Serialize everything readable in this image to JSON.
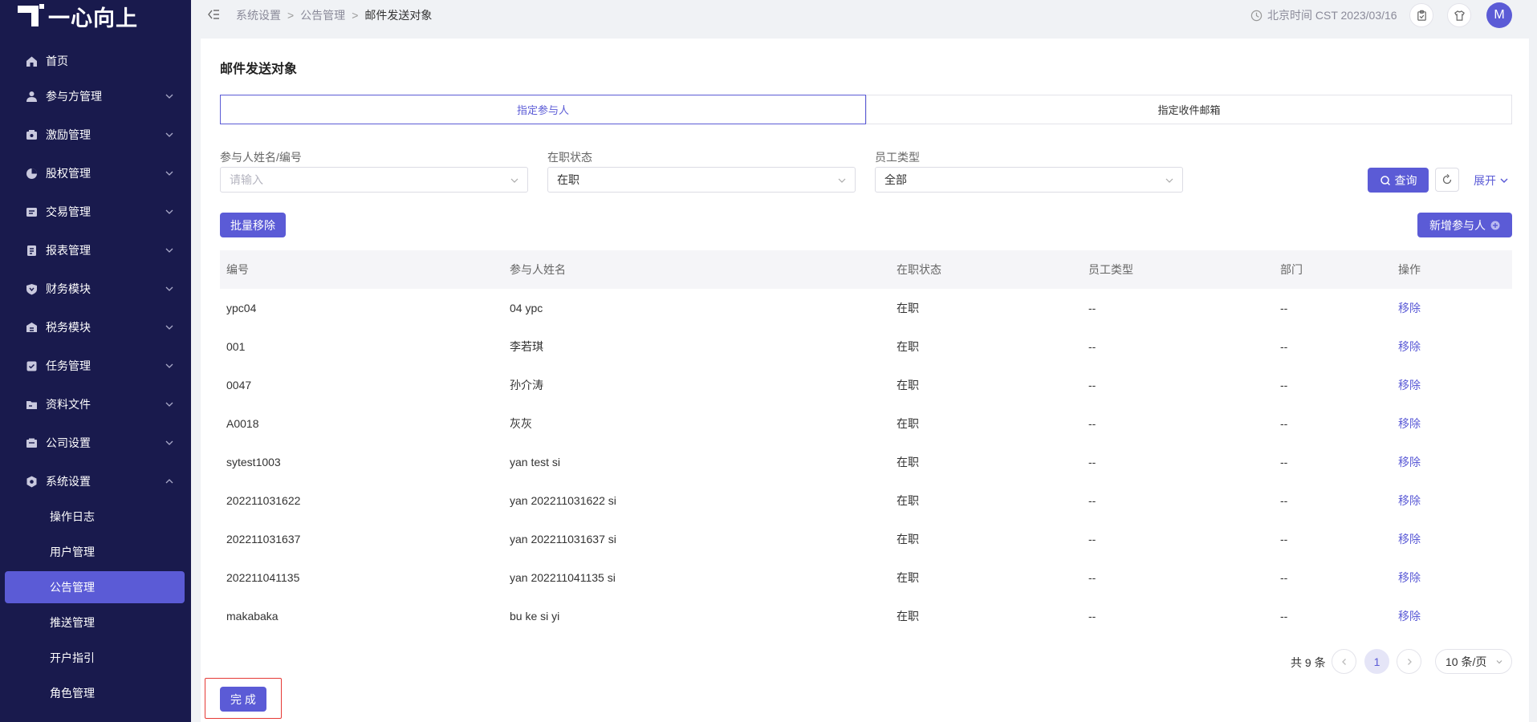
{
  "sidebar": {
    "logo_text": "一心向上",
    "items": [
      {
        "label": "首页",
        "icon": "home-icon"
      },
      {
        "label": "参与方管理",
        "icon": "participants-icon"
      },
      {
        "label": "激励管理",
        "icon": "incentive-icon"
      },
      {
        "label": "股权管理",
        "icon": "equity-icon"
      },
      {
        "label": "交易管理",
        "icon": "trade-icon"
      },
      {
        "label": "报表管理",
        "icon": "report-icon"
      },
      {
        "label": "财务模块",
        "icon": "finance-icon"
      },
      {
        "label": "税务模块",
        "icon": "tax-icon"
      },
      {
        "label": "任务管理",
        "icon": "task-icon"
      },
      {
        "label": "资料文件",
        "icon": "folder-icon"
      },
      {
        "label": "公司设置",
        "icon": "company-icon"
      },
      {
        "label": "系统设置",
        "icon": "system-icon"
      }
    ],
    "sub_items": [
      {
        "label": "操作日志"
      },
      {
        "label": "用户管理"
      },
      {
        "label": "公告管理"
      },
      {
        "label": "推送管理"
      },
      {
        "label": "开户指引"
      },
      {
        "label": "角色管理"
      }
    ]
  },
  "topbar": {
    "breadcrumb": [
      "系统设置",
      "公告管理",
      "邮件发送对象"
    ],
    "clock_text": "北京时间 CST 2023/03/16",
    "avatar_letter": "M"
  },
  "page": {
    "title": "邮件发送对象",
    "tabs": [
      "指定参与人",
      "指定收件邮箱"
    ],
    "filters": [
      {
        "label": "参与人姓名/编号",
        "placeholder": "请输入",
        "value": ""
      },
      {
        "label": "在职状态",
        "value": "在职"
      },
      {
        "label": "员工类型",
        "value": "全部"
      }
    ],
    "query_label": "查询",
    "expand_label": "展开",
    "batch_remove_label": "批量移除",
    "add_participant_label": "新增参与人",
    "done_label": "完 成"
  },
  "table": {
    "columns": [
      "编号",
      "参与人姓名",
      "在职状态",
      "员工类型",
      "部门",
      "操作"
    ],
    "rows": [
      [
        "ypc04",
        "04 ypc",
        "在职",
        "--",
        "--",
        "移除"
      ],
      [
        "001",
        "李若琪",
        "在职",
        "--",
        "--",
        "移除"
      ],
      [
        "0047",
        "孙介涛",
        "在职",
        "--",
        "--",
        "移除"
      ],
      [
        "A0018",
        "灰灰",
        "在职",
        "--",
        "--",
        "移除"
      ],
      [
        "sytest1003",
        "yan test si",
        "在职",
        "--",
        "--",
        "移除"
      ],
      [
        "202211031622",
        "yan 202211031622 si",
        "在职",
        "--",
        "--",
        "移除"
      ],
      [
        "202211031637",
        "yan 202211031637 si",
        "在职",
        "--",
        "--",
        "移除"
      ],
      [
        "202211041135",
        "yan 202211041135 si",
        "在职",
        "--",
        "--",
        "移除"
      ],
      [
        "makabaka",
        "bu ke si yi",
        "在职",
        "--",
        "--",
        "移除"
      ]
    ]
  },
  "pagination": {
    "total_text": "共 9 条",
    "current_page": "1",
    "page_size": "10 条/页"
  },
  "colors": {
    "sidebar_bg": "#191a4d",
    "accent": "#5b5bd6",
    "highlight_outline": "#e53935"
  }
}
